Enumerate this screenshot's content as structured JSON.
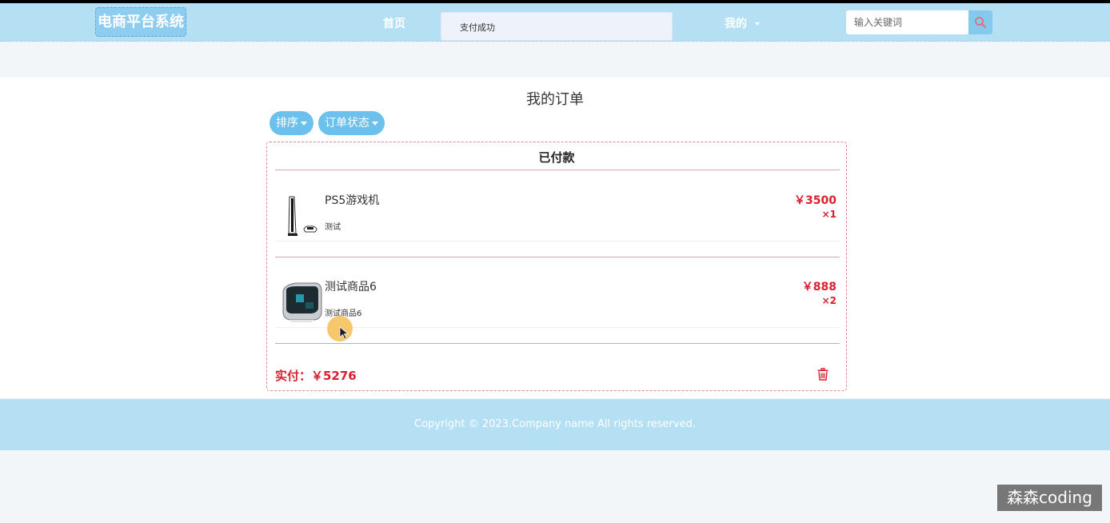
{
  "navbar": {
    "brand": "电商平台系统",
    "home_label": "首页",
    "toast_text": "支付成功",
    "mine_label": "我的",
    "search_placeholder": "输入关键词"
  },
  "page": {
    "title": "我的订单",
    "sort_label": "排序",
    "status_filter_label": "订单状态"
  },
  "order": {
    "status": "已付款",
    "items": [
      {
        "name": "PS5游戏机",
        "desc": "测试",
        "price": "￥3500",
        "qty": "×1"
      },
      {
        "name": "测试商品6",
        "desc": "测试商品6",
        "price": "￥888",
        "qty": "×2"
      }
    ],
    "total_label": "实付：￥5276"
  },
  "footer": {
    "copyright": "Copyright © 2023.Company name All rights reserved."
  },
  "watermark": "森森coding",
  "colors": {
    "navbar": "#b5dff3",
    "accent": "#6cc0ec",
    "price": "#d9202f"
  }
}
